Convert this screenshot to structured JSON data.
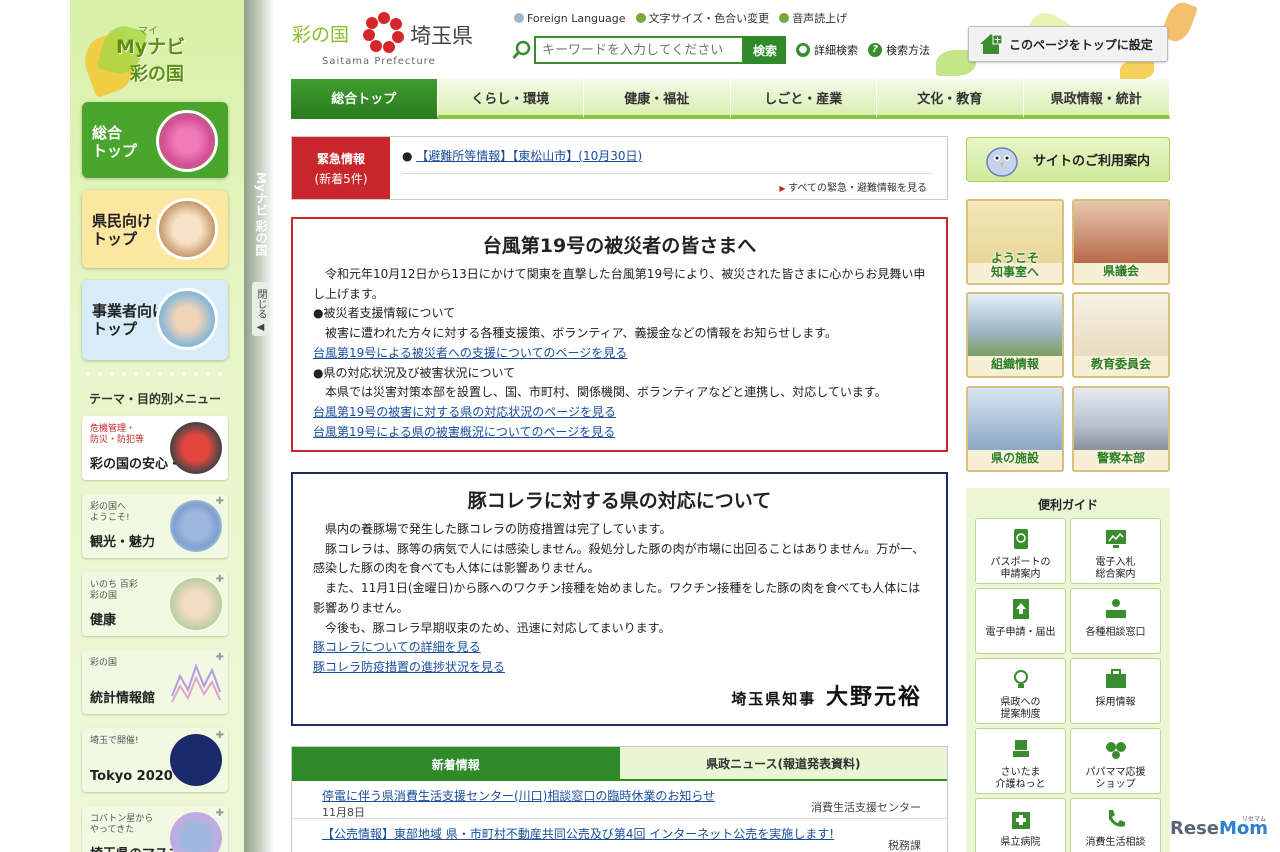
{
  "sidebar": {
    "brand_ruby": "マイ",
    "brand_line1": "Myナビ",
    "brand_line2": "彩の国",
    "rail_label": "Myナビ 彩の国",
    "close_label": "閉じる ◀",
    "nav": [
      {
        "label": "総合\nトップ",
        "color": "#4aa52c"
      },
      {
        "label": "県民向け\nトップ",
        "color": "#f3c231"
      },
      {
        "label": "事業者向け\nトップ",
        "color": "#64b0dc"
      }
    ],
    "theme_heading": "テーマ・目的別メニュー",
    "theme_cards": [
      {
        "small": "危機管理・\n防災・防犯等",
        "big": "彩の国の安心・安全"
      },
      {
        "small": "彩の国へ\nようこそ!",
        "big": "観光・魅力"
      },
      {
        "small": "いのち 百彩\n彩の国",
        "big": "健康"
      },
      {
        "small": "彩の国",
        "big": "統計情報館"
      },
      {
        "small": "埼玉で開催!",
        "big": "Tokyo 2020"
      },
      {
        "small": "コバトン星から\nやってきた",
        "big": "埼玉県のマスコット"
      }
    ]
  },
  "header": {
    "logo_left": "彩の国",
    "logo_right": "埼玉県",
    "logo_en": "Saitama Prefecture",
    "utility": [
      "Foreign Language",
      "文字サイズ・色合い変更",
      "音声読上げ"
    ],
    "search_placeholder": "キーワードを入力してください",
    "search_button": "検索",
    "advanced_search": "詳細検索",
    "search_help": "検索方法",
    "set_top": "このページをトップに設定"
  },
  "global_nav": [
    "総合トップ",
    "くらし・環境",
    "健康・福祉",
    "しごと・産業",
    "文化・教育",
    "県政情報・統計"
  ],
  "emergency": {
    "label_line1": "緊急情報",
    "label_line2": "(新着5件)",
    "item": "【避難所等情報】【東松山市】(10月30日)",
    "all_link": "すべての緊急・避難情報を見る"
  },
  "typhoon_notice": {
    "title": "台風第19号の被災者の皆さまへ",
    "intro": "令和元年10月12日から13日にかけて関東を直撃した台風第19号により、被災された皆さまに心からお見舞い申し上げます。",
    "h1": "●被災者支援情報について",
    "p1": "被害に遭われた方々に対する各種支援策、ボランティア、義援金などの情報をお知らせします。",
    "link1": "台風第19号による被災者への支援についてのページを見る",
    "h2": "●県の対応状況及び被害状況について",
    "p2": "本県では災害対策本部を設置し、国、市町村、関係機関、ボランティアなどと連携し、対応しています。",
    "link2": "台風第19号の被害に対する県の対応状況のページを見る",
    "link3": "台風第19号による県の被害概況についてのページを見る"
  },
  "cholera_notice": {
    "title": "豚コレラに対する県の対応について",
    "p1": "県内の養豚場で発生した豚コレラの防疫措置は完了しています。",
    "p2": "豚コレラは、豚等の病気で人には感染しません。殺処分した豚の肉が市場に出回ることはありません。万が一、感染した豚の肉を食べても人体には影響ありません。",
    "p3": "また、11月1日(金曜日)から豚へのワクチン接種を始めました。ワクチン接種をした豚の肉を食べても人体には影響ありません。",
    "p4": "今後も、豚コレラ早期収束のため、迅速に対応してまいります。",
    "link1": "豚コレラについての詳細を見る",
    "link2": "豚コレラ防疫措置の進捗状況を見る",
    "signature_title": "埼玉県知事",
    "signature_name": "大野元裕"
  },
  "news": {
    "tab_active": "新着情報",
    "tab_other": "県政ニュース(報道発表資料)",
    "items": [
      {
        "title": "停電に伴う県消費生活支援センター(川口)相談窓口の臨時休業のお知らせ",
        "date": "11月8日",
        "source": "消費生活支援センター"
      },
      {
        "title": "【公売情報】東部地域 県・市町村不動産共同公売及び第4回 インターネット公売を実施します!",
        "date": "",
        "source": "税務課"
      }
    ]
  },
  "right": {
    "guide_button": "サイトのご利用案内",
    "tiles": [
      {
        "label": "ようこそ\n知事室へ",
        "bg": "#f3e7b8"
      },
      {
        "label": "県議会",
        "bg": "#c97a5a"
      },
      {
        "label": "組織情報",
        "bg": "#9fb6c8"
      },
      {
        "label": "教育委員会",
        "bg": "#e8dcc0"
      },
      {
        "label": "県の施設",
        "bg": "#8aa7c4"
      },
      {
        "label": "警察本部",
        "bg": "#b8c1cf"
      }
    ],
    "guide_heading": "便利ガイド",
    "guide_items": [
      {
        "label": "パスポートの\n申請案内",
        "icon": "passport-icon"
      },
      {
        "label": "電子入札\n総合案内",
        "icon": "monitor-icon"
      },
      {
        "label": "電子申請・届出",
        "icon": "upload-icon"
      },
      {
        "label": "各種相談窓口",
        "icon": "counter-icon"
      },
      {
        "label": "県政への\n提案制度",
        "icon": "lightbulb-icon"
      },
      {
        "label": "採用情報",
        "icon": "briefcase-icon"
      },
      {
        "label": "さいたま\n介護ねっと",
        "icon": "wheelchair-icon"
      },
      {
        "label": "パパママ応援\nショップ",
        "icon": "family-icon"
      },
      {
        "label": "県立病院",
        "icon": "hospital-icon"
      },
      {
        "label": "消費生活相談",
        "icon": "phone-icon"
      }
    ]
  },
  "watermark": {
    "text_a": "Rese",
    "text_b": "Mom",
    "small": "リセマム"
  },
  "colors": {
    "brand_green": "#2f8a2a",
    "alert_red": "#c9262b",
    "navy": "#1b2a6b"
  }
}
